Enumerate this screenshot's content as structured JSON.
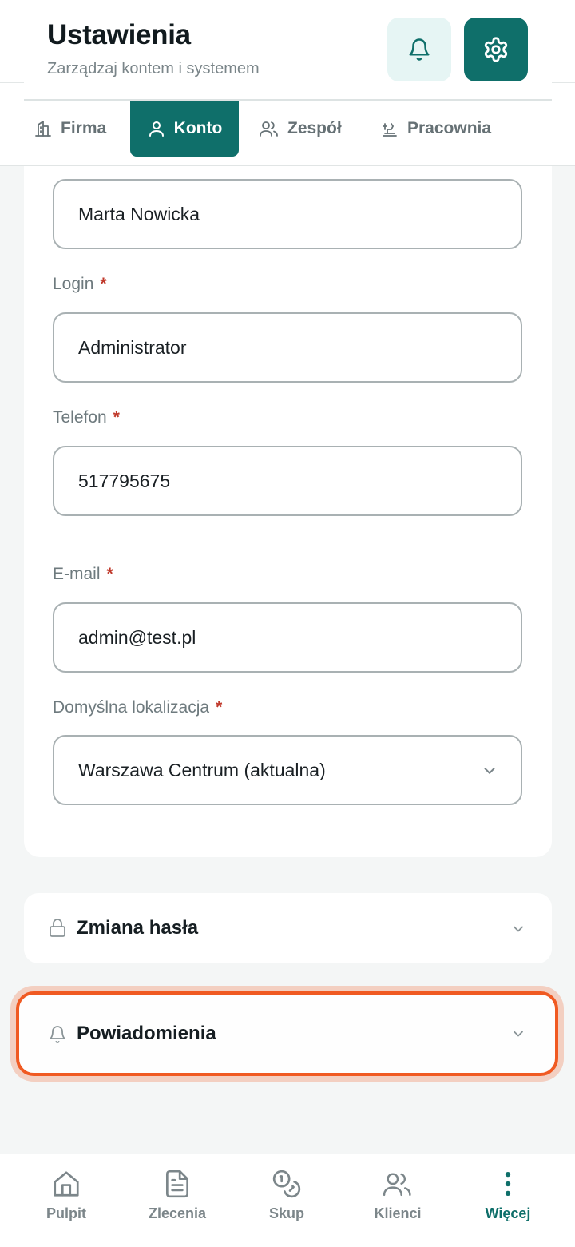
{
  "header": {
    "title": "Ustawienia",
    "subtitle": "Zarządzaj kontem i systemem"
  },
  "tabs": [
    {
      "label": "Firma",
      "icon": "building-icon",
      "active": false
    },
    {
      "label": "Konto",
      "icon": "user-icon",
      "active": true
    },
    {
      "label": "Zespół",
      "icon": "users-icon",
      "active": false
    },
    {
      "label": "Pracownia",
      "icon": "workbench-icon",
      "active": false
    }
  ],
  "form": {
    "name_value": "Marta Nowicka",
    "login_label": "Login",
    "login_value": "Administrator",
    "phone_label": "Telefon",
    "phone_value": "517795675",
    "email_label": "E-mail",
    "email_value": "admin@test.pl",
    "location_label": "Domyślna lokalizacja",
    "location_value": "Warszawa Centrum (aktualna)",
    "required_mark": "*"
  },
  "sections": {
    "password": "Zmiana hasła",
    "notifications": "Powiadomienia"
  },
  "nav": [
    {
      "label": "Pulpit",
      "icon": "home-icon",
      "active": false
    },
    {
      "label": "Zlecenia",
      "icon": "document-icon",
      "active": false
    },
    {
      "label": "Skup",
      "icon": "coins-icon",
      "active": false
    },
    {
      "label": "Klienci",
      "icon": "users-icon",
      "active": false
    },
    {
      "label": "Więcej",
      "icon": "more-vertical-icon",
      "active": true
    }
  ],
  "colors": {
    "primary": "#0f6f6a",
    "primary_light": "#e6f5f4",
    "required": "#c0392b",
    "highlight": "#f05a22"
  }
}
